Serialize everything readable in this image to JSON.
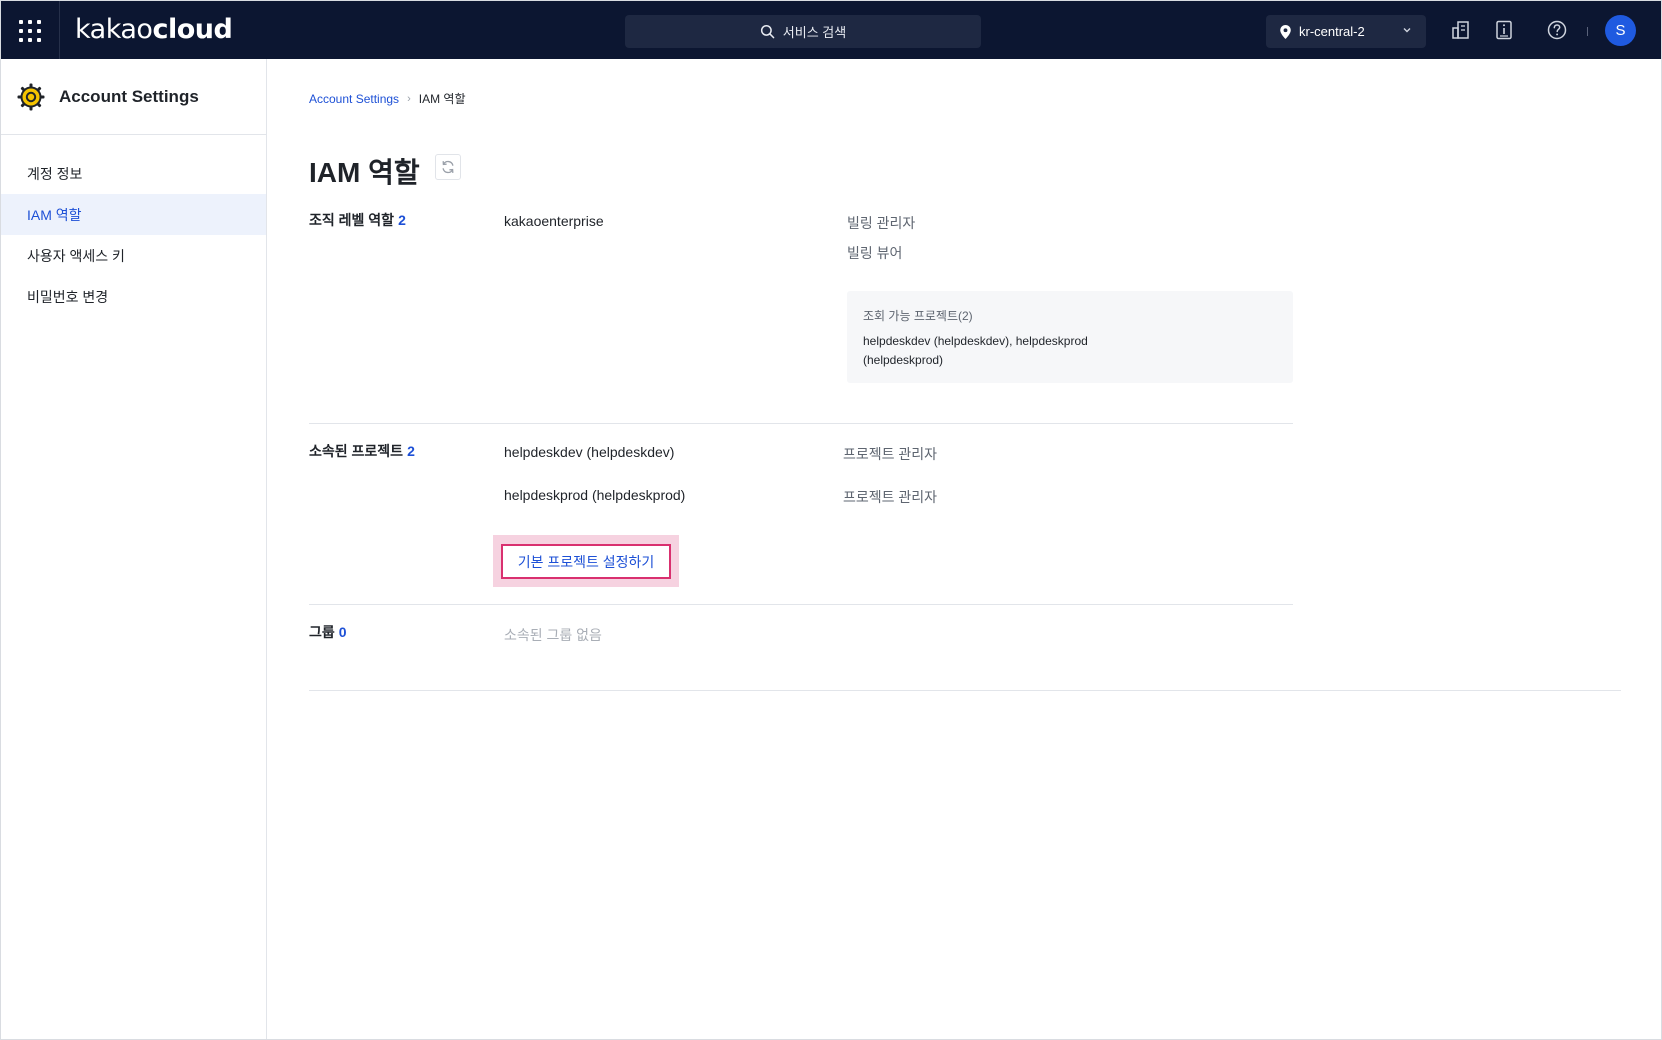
{
  "topbar": {
    "logo_light": "kakao",
    "logo_bold": "cloud",
    "search_placeholder": "서비스 검색",
    "region": "kr-central-2",
    "avatar_initial": "S",
    "icons": [
      "apps-grid-icon",
      "search-icon",
      "location-pin-icon",
      "chevron-down-icon",
      "building-icon",
      "info-book-icon",
      "help-icon"
    ]
  },
  "sidebar": {
    "title": "Account Settings",
    "icon": "settings-gear-icon",
    "items": [
      {
        "label": "계정 정보",
        "active": false
      },
      {
        "label": "IAM 역할",
        "active": true
      },
      {
        "label": "사용자 액세스 키",
        "active": false
      },
      {
        "label": "비밀번호 변경",
        "active": false
      }
    ]
  },
  "breadcrumb": {
    "root": "Account Settings",
    "current": "IAM 역할"
  },
  "page": {
    "title": "IAM 역할",
    "refresh_icon": "refresh-icon"
  },
  "org_roles": {
    "label": "조직 레벨 역할",
    "count": "2",
    "org_name": "kakaoenterprise",
    "roles": [
      "빌링 관리자",
      "빌링 뷰어"
    ],
    "viewable": {
      "title": "조회 가능 프로젝트(2)",
      "body": "helpdeskdev (helpdeskdev), helpdeskprod (helpdeskprod)"
    }
  },
  "projects": {
    "label": "소속된 프로젝트",
    "count": "2",
    "items": [
      {
        "name": "helpdeskdev (helpdeskdev)",
        "role": "프로젝트 관리자"
      },
      {
        "name": "helpdeskprod (helpdeskprod)",
        "role": "프로젝트 관리자"
      }
    ],
    "default_button": "기본 프로젝트 설정하기"
  },
  "groups": {
    "label": "그룹",
    "count": "0",
    "empty": "소속된 그룹 없음"
  },
  "colors": {
    "topbar_bg": "#0c1631",
    "accent_blue": "#1d50d6",
    "highlight_border": "#d9306f",
    "highlight_bg": "#f6d2e0",
    "sidebar_active_bg": "#edf2fc"
  }
}
